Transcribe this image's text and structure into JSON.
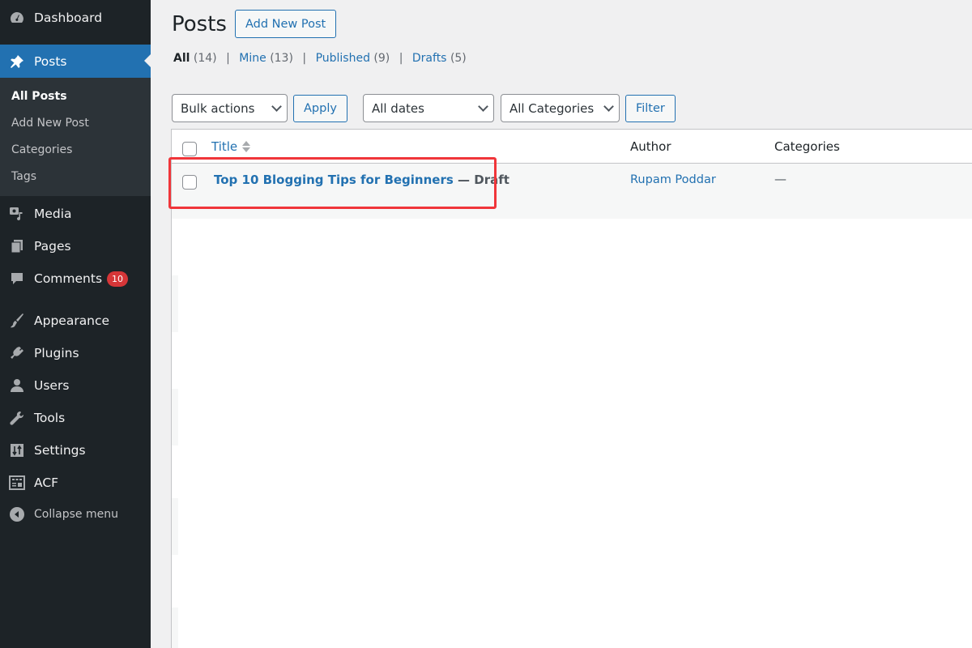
{
  "sidebar": {
    "dashboard": "Dashboard",
    "posts": "Posts",
    "submenu": [
      "All Posts",
      "Add New Post",
      "Categories",
      "Tags"
    ],
    "media": "Media",
    "pages": "Pages",
    "comments": "Comments",
    "comments_badge": "10",
    "appearance": "Appearance",
    "plugins": "Plugins",
    "users": "Users",
    "tools": "Tools",
    "settings": "Settings",
    "acf": "ACF",
    "collapse": "Collapse menu"
  },
  "header": {
    "title": "Posts",
    "add_new": "Add New Post"
  },
  "filters": {
    "all": "All",
    "all_count": "(14)",
    "mine": "Mine",
    "mine_count": "(13)",
    "published": "Published",
    "published_count": "(9)",
    "drafts": "Drafts",
    "drafts_count": "(5)",
    "separator": "|"
  },
  "tablenav": {
    "bulk_actions": "Bulk actions",
    "apply": "Apply",
    "dates": "All dates",
    "categories": "All Categories",
    "filter": "Filter"
  },
  "table": {
    "columns": [
      "Title",
      "Author",
      "Categories"
    ],
    "rows": [
      {
        "title": "Top 10 Blogging Tips for Beginners",
        "state": " — Draft",
        "author": "Rupam Poddar",
        "categories": "—"
      }
    ]
  },
  "colors": {
    "accent": "#2271b1",
    "sidebar_bg": "#1d2327",
    "badge": "#d63638",
    "highlight": "#f0353a"
  }
}
